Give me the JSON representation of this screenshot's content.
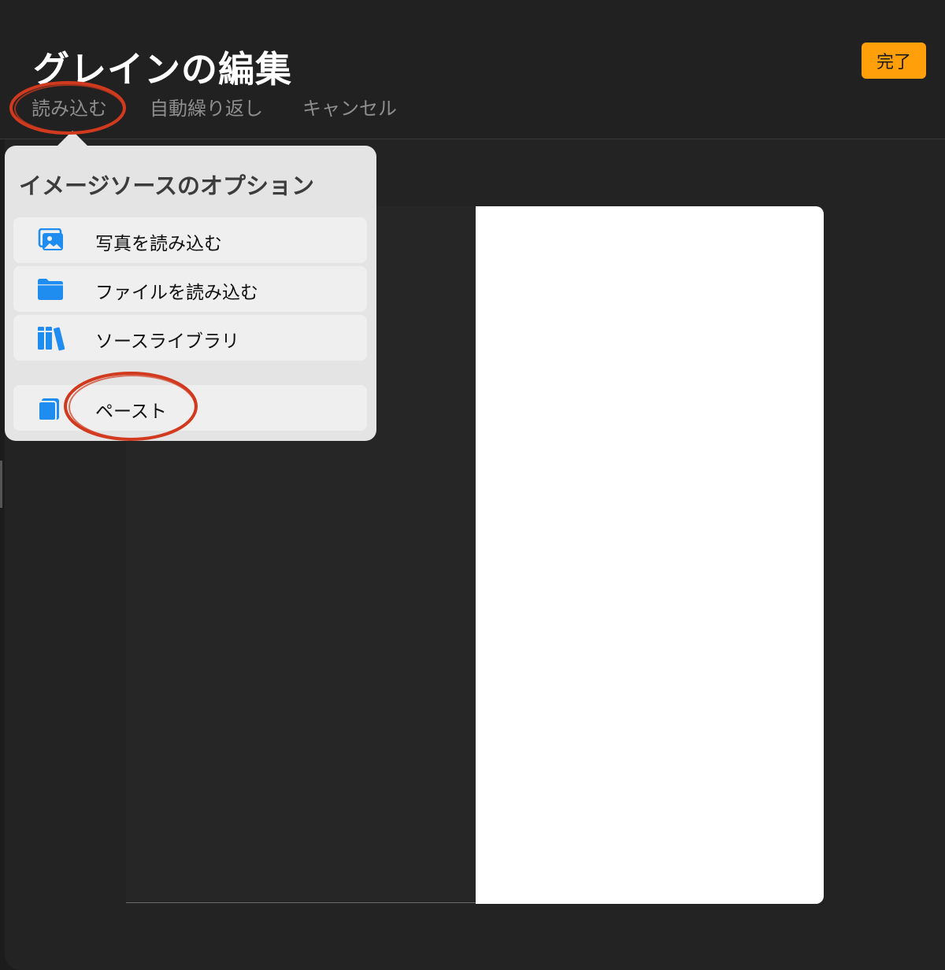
{
  "header": {
    "title": "グレインの編集",
    "toolbar": {
      "import_label": "読み込む",
      "autorepeat_label": "自動繰り返し",
      "cancel_label": "キャンセル"
    },
    "done_label": "完了"
  },
  "popover": {
    "title": "イメージソースのオプション",
    "items": [
      {
        "label": "写真を読み込む",
        "icon": "photo-icon"
      },
      {
        "label": "ファイルを読み込む",
        "icon": "folder-icon"
      },
      {
        "label": "ソースライブラリ",
        "icon": "books-icon"
      },
      {
        "label": "ペースト",
        "icon": "clipboard-icon"
      }
    ]
  },
  "colors": {
    "accent": "#ff9f0a",
    "icon_blue": "#1f8cf0",
    "annotation_red": "#d13a1e",
    "background": "#232323"
  }
}
